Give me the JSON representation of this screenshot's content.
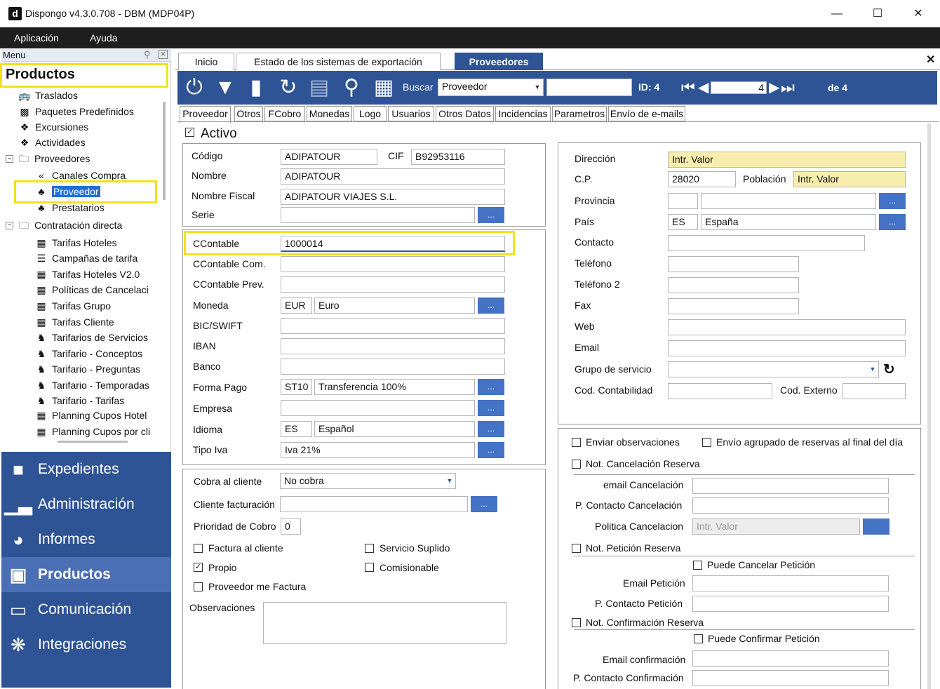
{
  "window": {
    "title": "Dispongo v4.3.0.708 - DBM (MDP04P)",
    "logo": "d"
  },
  "menubar": {
    "items": [
      "Aplicación",
      "Ayuda"
    ]
  },
  "menu_panel": {
    "header": "Menu",
    "section": "Productos",
    "items": [
      {
        "label": "Traslados",
        "icon": "bus-icon"
      },
      {
        "label": "Paquetes Predefinidos",
        "icon": "package-icon"
      },
      {
        "label": "Excursiones",
        "icon": "tag-icon"
      },
      {
        "label": "Actividades",
        "icon": "tag-icon"
      },
      {
        "label": "Proveedores",
        "icon": "folder-icon"
      },
      {
        "label": "Canales Compra",
        "icon": "channel-icon"
      },
      {
        "label": "Proveedor",
        "icon": "puzzle-icon"
      },
      {
        "label": "Prestatarios",
        "icon": "puzzle-icon"
      },
      {
        "label": "Contratación directa",
        "icon": "folder-icon"
      },
      {
        "label": "Tarifas Hoteles",
        "icon": "calendar-icon"
      },
      {
        "label": "Campañas de tarifa",
        "icon": "list-icon"
      },
      {
        "label": "Tarifas Hoteles V2.0",
        "icon": "calendar-icon"
      },
      {
        "label": "Políticas de Cancelaci",
        "icon": "calendar-icon"
      },
      {
        "label": "Tarifas Grupo",
        "icon": "calendar-icon"
      },
      {
        "label": "Tarifas Cliente",
        "icon": "calendar-icon"
      },
      {
        "label": "Tarifarios de Servicios",
        "icon": "service-icon"
      },
      {
        "label": "Tarifario - Conceptos",
        "icon": "service-icon"
      },
      {
        "label": "Tarifario - Preguntas",
        "icon": "service-icon"
      },
      {
        "label": "Tarifario - Temporadas",
        "icon": "service-icon"
      },
      {
        "label": "Tarifario - Tarifas",
        "icon": "service-icon"
      },
      {
        "label": "Planning Cupos Hotel",
        "icon": "calendar-icon"
      },
      {
        "label": "Planning Cupos por cli",
        "icon": "calendar-icon"
      }
    ]
  },
  "nav": [
    {
      "label": "Expedientes",
      "icon": "folder-icon"
    },
    {
      "label": "Administración",
      "icon": "bar-chart-icon"
    },
    {
      "label": "Informes",
      "icon": "pie-chart-icon"
    },
    {
      "label": "Productos",
      "icon": "briefcase-icon",
      "active": true
    },
    {
      "label": "Comunicación",
      "icon": "monitor-icon"
    },
    {
      "label": "Integraciones",
      "icon": "puzzle-icon"
    }
  ],
  "tabs": [
    "Inicio",
    "Estado de los sistemas de exportación",
    "Proveedores"
  ],
  "toolbar": {
    "buscar_label": "Buscar",
    "buscar_value": "Proveedor",
    "search_text": "",
    "id_label": "ID: 4",
    "record": "4",
    "de_label": "de 4"
  },
  "subtabs": [
    "Proveedor",
    "Otros",
    "FCobro",
    "Monedas",
    "Logo",
    "Usuarios",
    "Otros Datos",
    "Incidencias",
    "Parametros",
    "Envío de e-mails"
  ],
  "activo_label": "Activo",
  "general": {
    "codigo_label": "Código",
    "codigo": "ADIPATOUR",
    "cif_label": "CIF",
    "cif": "B92953116",
    "nombre_label": "Nombre",
    "nombre": "ADIPATOUR",
    "nombre_fiscal_label": "Nombre Fiscal",
    "nombre_fiscal": "ADIPATOUR VIAJES S.L.",
    "serie_label": "Serie",
    "serie": ""
  },
  "financial": {
    "ccontable_label": "CContable",
    "ccontable": "1000014",
    "ccontable_com_label": "CContable Com.",
    "ccontable_com": "",
    "ccontable_prev_label": "CContable Prev.",
    "ccontable_prev": "",
    "moneda_label": "Moneda",
    "moneda_code": "EUR",
    "moneda_name": "Euro",
    "bic_label": "BIC/SWIFT",
    "bic": "",
    "iban_label": "IBAN",
    "iban": "",
    "banco_label": "Banco",
    "banco": "",
    "forma_pago_label": "Forma Pago",
    "forma_pago_code": "ST10",
    "forma_pago_name": "Transferencia 100%",
    "empresa_label": "Empresa",
    "empresa": "",
    "idioma_label": "Idioma",
    "idioma_code": "ES",
    "idioma_name": "Español",
    "tipo_iva_label": "Tipo Iva",
    "tipo_iva": "Iva 21%",
    "ellipsis": "..."
  },
  "cobro": {
    "cobra_label": "Cobra al cliente",
    "cobra": "No cobra",
    "cliente_fact_label": "Cliente facturación",
    "cliente_fact": "",
    "prioridad_label": "Prioridad de Cobro",
    "prioridad": "0",
    "factura_cliente": "Factura al cliente",
    "servicio_suplido": "Servicio Suplido",
    "propio": "Propio",
    "comisionable": "Comisionable",
    "proveedor_factura": "Proveedor me Factura",
    "observaciones_label": "Observaciones",
    "check_mark": "✓"
  },
  "contact": {
    "direccion_label": "Dirección",
    "direccion": "Intr. Valor",
    "cp_label": "C.P.",
    "cp": "28020",
    "poblacion_label": "Población",
    "poblacion": "Intr. Valor",
    "provincia_label": "Provincia",
    "provincia_code": "",
    "provincia": "",
    "pais_label": "País",
    "pais_code": "ES",
    "pais": "España",
    "contacto_label": "Contacto",
    "contacto": "",
    "telefono_label": "Teléfono",
    "telefono": "",
    "telefono2_label": "Teléfono 2",
    "telefono2": "",
    "fax_label": "Fax",
    "fax": "",
    "web_label": "Web",
    "web": "",
    "email_label": "Email",
    "email": "",
    "grupo_label": "Grupo de servicio",
    "grupo": "",
    "cod_contab_label": "Cod. Contabilidad",
    "cod_contab": "",
    "cod_externo_label": "Cod. Externo",
    "cod_externo": ""
  },
  "notifications": {
    "enviar_obs": "Enviar observaciones",
    "envio_agrupado": "Envío agrupado de reservas al final del día",
    "not_cancel": "Not. Cancelación Reserva",
    "email_cancel_label": "email Cancelación",
    "email_cancel": "",
    "p_contacto_cancel_label": "P. Contacto Cancelación",
    "p_contacto_cancel": "",
    "politica_cancel_label": "Politica Cancelacion",
    "politica_cancel": "Intr. Valor",
    "not_peticion": "Not. Petición Reserva",
    "puede_cancelar": "Puede Cancelar Petición",
    "email_peticion_label": "Email Petición",
    "email_peticion": "",
    "p_contacto_peticion_label": "P. Contacto Petición",
    "p_contacto_peticion": "",
    "not_confirm": "Not. Confirmación Reserva",
    "puede_confirmar": "Puede Confirmar Petición",
    "email_confirm_label": "Email confirmación",
    "email_confirm": "",
    "p_contacto_confirm_label": "P. Contacto Confirmación",
    "p_contacto_confirm": ""
  },
  "colors": {
    "accent": "#2f5496",
    "highlight": "#f4e11a",
    "button": "#4472c4",
    "required": "#f7eead"
  }
}
